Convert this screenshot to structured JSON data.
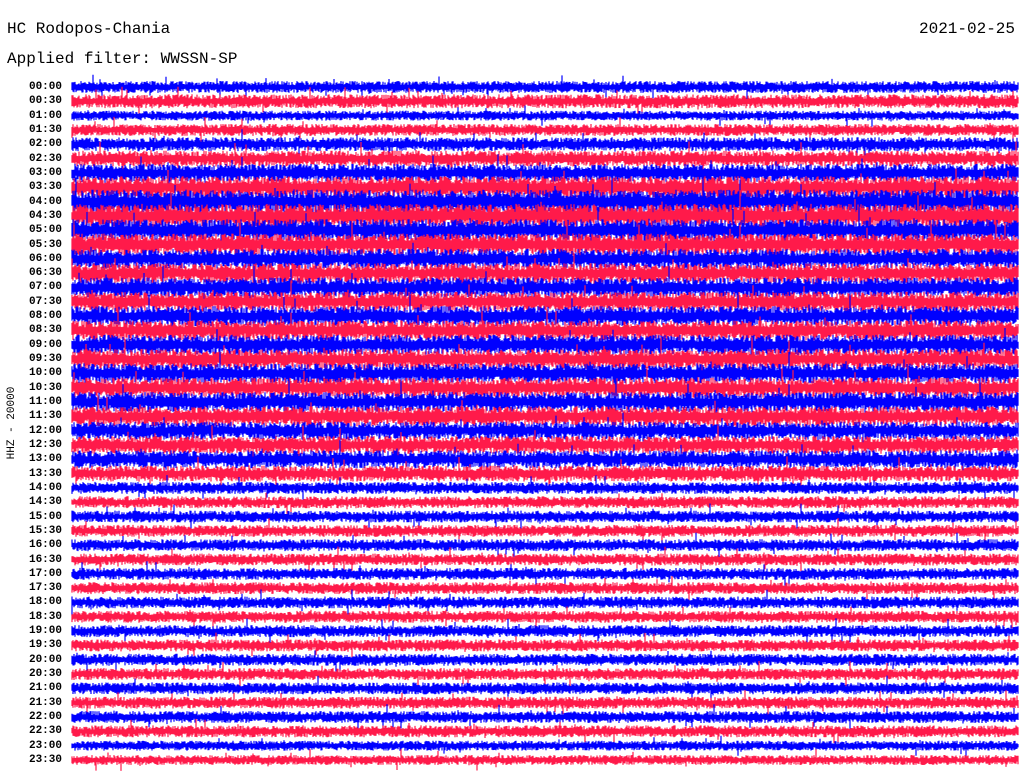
{
  "header": {
    "station": "HC Rodopos-Chania",
    "date": "2021-02-25",
    "filter": "Applied filter: WWSSN-SP"
  },
  "chart_data": {
    "type": "line",
    "title": "HC Rodopos-Chania",
    "ylabel": "HHZ - 20000",
    "colors": [
      "#0000ff",
      "#ff1a4a"
    ],
    "tick_labels": [
      "00:00",
      "00:30",
      "01:00",
      "01:30",
      "02:00",
      "02:30",
      "03:00",
      "03:30",
      "04:00",
      "04:30",
      "05:00",
      "05:30",
      "06:00",
      "06:30",
      "07:00",
      "07:30",
      "08:00",
      "08:30",
      "09:00",
      "09:30",
      "10:00",
      "10:30",
      "11:00",
      "11:30",
      "12:00",
      "12:30",
      "13:00",
      "13:30",
      "14:00",
      "14:30",
      "15:00",
      "15:30",
      "16:00",
      "16:30",
      "17:00",
      "17:30",
      "18:00",
      "18:30",
      "19:00",
      "19:30",
      "20:00",
      "20:30",
      "21:00",
      "21:30",
      "22:00",
      "22:30",
      "23:00",
      "23:30"
    ],
    "noise_level": [
      6,
      7,
      5,
      6,
      7,
      8,
      9,
      11,
      12,
      12,
      11,
      11,
      10,
      10,
      10,
      10,
      10,
      10,
      10,
      10,
      10,
      10,
      10,
      10,
      9,
      9,
      9,
      8,
      6,
      6,
      6,
      6,
      6,
      6,
      6,
      6,
      6,
      6,
      6,
      6,
      6,
      6,
      6,
      6,
      6,
      6,
      5,
      5
    ]
  }
}
